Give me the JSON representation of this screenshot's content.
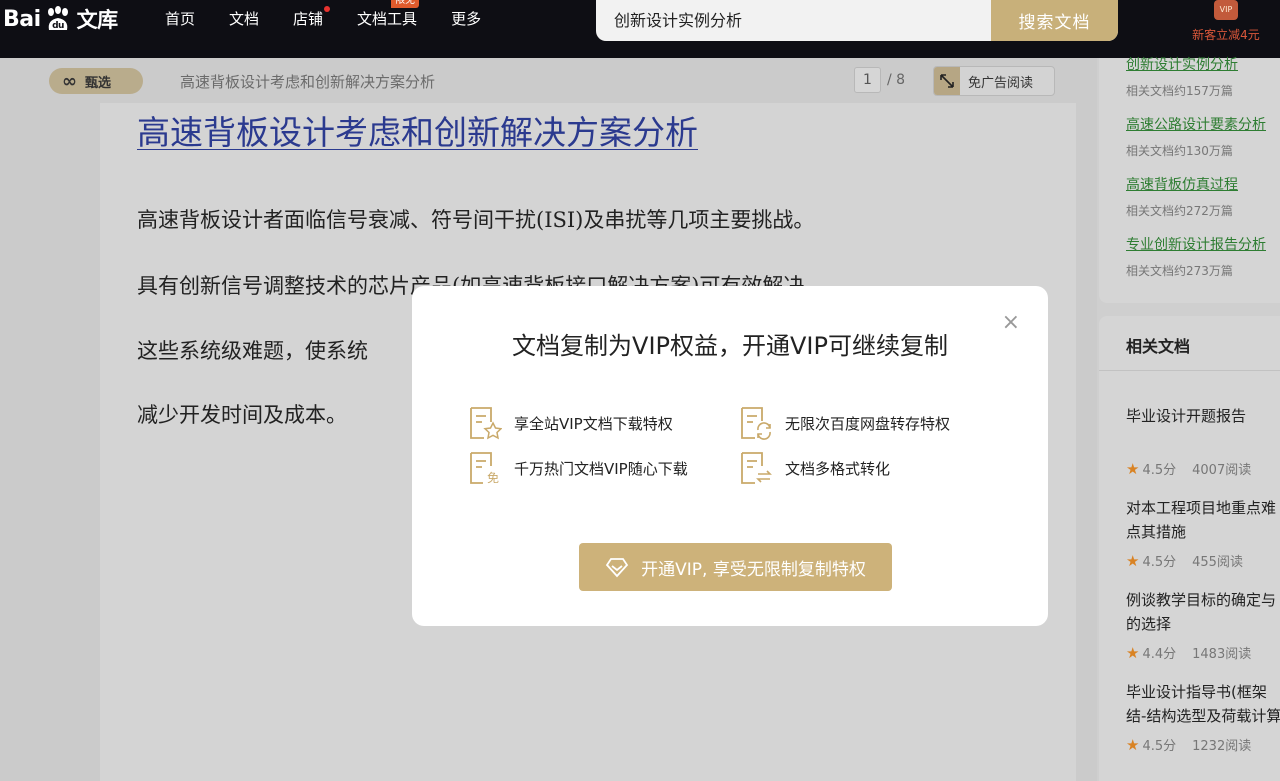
{
  "topbar": {
    "logo_text_left": "Bai",
    "logo_text_mid": "du",
    "logo_text_right": "文库",
    "nav": [
      {
        "label": "首页"
      },
      {
        "label": "文档"
      },
      {
        "label": "店铺",
        "has_dot": true
      },
      {
        "label": "文档工具",
        "tag": "限免"
      },
      {
        "label": "更多"
      }
    ],
    "search_value": "创新设计实例分析",
    "search_button": "搜索文档",
    "promo_badge": "VIP",
    "promo_text": "新客立减4元"
  },
  "doc_header": {
    "badge_icon": "∞",
    "badge_label": "甄选",
    "title": "高速背板设计考虑和创新解决方案分析",
    "page_current": "1",
    "page_total": "/ 8",
    "adfree_label": "免广告阅读"
  },
  "document": {
    "heading": "高速背板设计考虑和创新解决方案分析",
    "lines": [
      "高速背板设计者面临信号衰减、符号间干扰(ISI)及串扰等几项主要挑战。",
      "具有创新信号调整技术的芯片产品(如高速背板接口解决方案)可有效解决",
      "这些系统级难题，使系统",
      "减少开发时间及成本。"
    ]
  },
  "sidebar": {
    "related_searches": [
      {
        "link": "创新设计实例分析",
        "count": "相关文档约157万篇"
      },
      {
        "link": "高速公路设计要素分析",
        "count": "相关文档约130万篇"
      },
      {
        "link": "高速背板仿真过程",
        "count": "相关文档约272万篇"
      },
      {
        "link": "专业创新设计报告分析",
        "count": "相关文档约273万篇"
      }
    ],
    "related_docs_heading": "相关文档",
    "related_docs": [
      {
        "title": "毕业设计开题报告",
        "score": "4.5分",
        "reads": "4007阅读"
      },
      {
        "title": "对本工程项目地重点难点其措施",
        "score": "4.5分",
        "reads": "455阅读"
      },
      {
        "title": "例谈教学目标的确定与的选择",
        "score": "4.4分",
        "reads": "1483阅读"
      },
      {
        "title": "毕业设计指导书(框架结-结构选型及荷载计算",
        "score": "4.5分",
        "reads": "1232阅读"
      }
    ]
  },
  "modal": {
    "title": "文档复制为VIP权益，开通VIP可继续复制",
    "close_icon": "×",
    "perks": [
      {
        "label": "享全站VIP文档下载特权",
        "icon": "doc-star-icon"
      },
      {
        "label": "无限次百度网盘转存特权",
        "icon": "doc-sync-icon"
      },
      {
        "label": "千万热门文档VIP随心下载",
        "icon": "doc-free-icon"
      },
      {
        "label": "文档多格式转化",
        "icon": "doc-convert-icon"
      }
    ],
    "perk_free_glyph": "免",
    "cta": "开通VIP, 享受无限制复制特权"
  },
  "colors": {
    "gold": "#cdb27a",
    "link_green": "#2e7d32",
    "heading_blue": "#2b3a8f",
    "promo_red": "#d9573a"
  }
}
